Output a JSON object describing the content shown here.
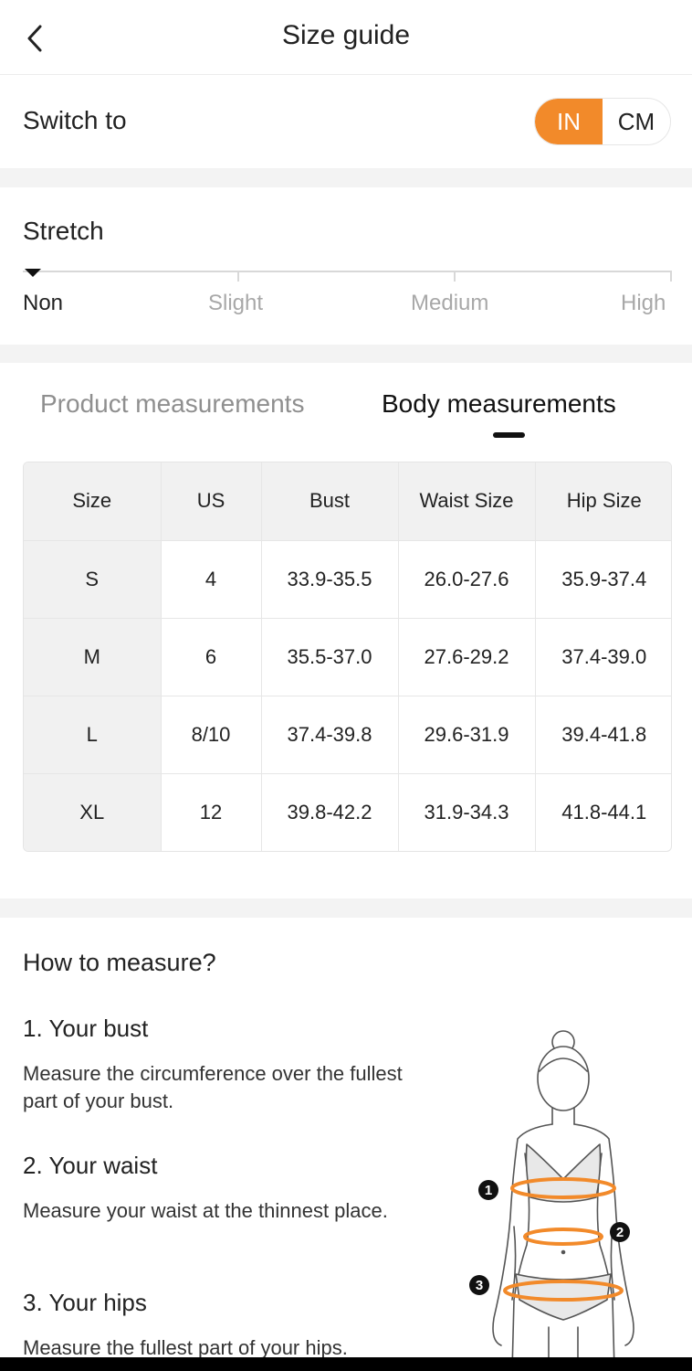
{
  "header": {
    "title": "Size guide",
    "back_icon": "chevron-left-icon"
  },
  "switch": {
    "label": "Switch to",
    "options": [
      "IN",
      "CM"
    ],
    "selected": "IN",
    "accent_color": "#f28a2a"
  },
  "stretch": {
    "title": "Stretch",
    "levels": [
      "Non",
      "Slight",
      "Medium",
      "High"
    ],
    "selected": "Non"
  },
  "tabs": {
    "items": [
      "Product measurements",
      "Body measurements"
    ],
    "selected": "Body measurements"
  },
  "table": {
    "headers": [
      "Size",
      "US",
      "Bust",
      "Waist Size",
      "Hip Size"
    ],
    "rows": [
      [
        "S",
        "4",
        "33.9-35.5",
        "26.0-27.6",
        "35.9-37.4"
      ],
      [
        "M",
        "6",
        "35.5-37.0",
        "27.6-29.2",
        "37.4-39.0"
      ],
      [
        "L",
        "8/10",
        "37.4-39.8",
        "29.6-31.9",
        "39.4-41.8"
      ],
      [
        "XL",
        "12",
        "39.8-42.2",
        "31.9-34.3",
        "41.8-44.1"
      ]
    ]
  },
  "how_to_measure": {
    "title": "How to measure?",
    "steps": [
      {
        "title": "1. Your bust",
        "text": "Measure the circumference over the fullest part of your bust."
      },
      {
        "title": "2. Your waist",
        "text": "Measure your waist at the thinnest place."
      },
      {
        "title": "3. Your hips",
        "text": "Measure the fullest part of your hips."
      }
    ],
    "figure_markers": [
      "1",
      "2",
      "3"
    ]
  }
}
